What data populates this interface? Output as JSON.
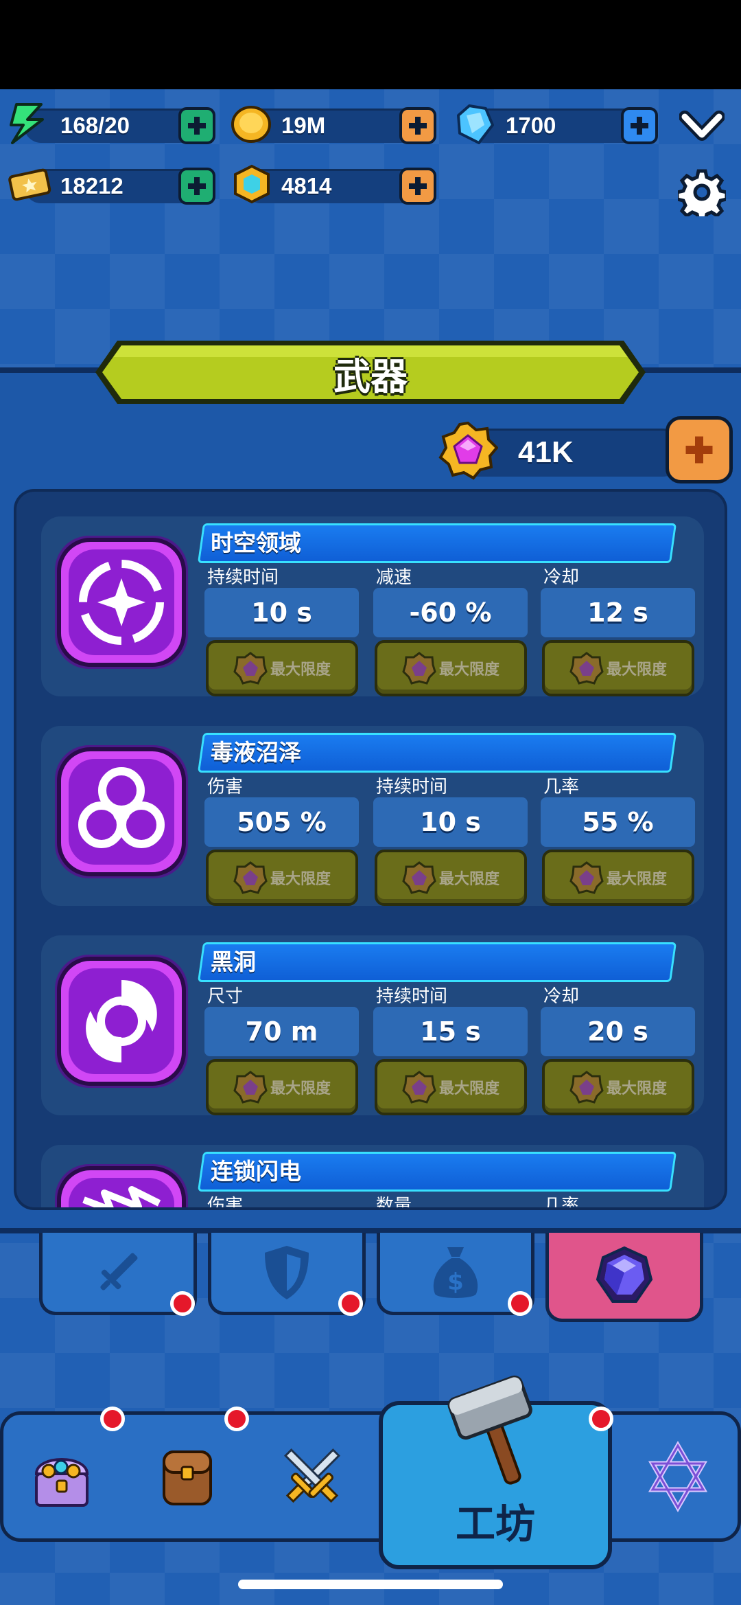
{
  "resources": {
    "energy": {
      "value": "168/20",
      "icon": "lightning-icon"
    },
    "coins": {
      "value": "19M",
      "icon": "coin-icon"
    },
    "diamonds": {
      "value": "1700",
      "icon": "diamond-icon"
    },
    "tickets": {
      "value": "18212",
      "icon": "ticket-icon"
    },
    "gems": {
      "value": "4814",
      "icon": "gem-coin-icon"
    }
  },
  "header": {
    "title": "武器"
  },
  "upgrade_currency": {
    "value": "41K",
    "icon": "purple-gem-icon"
  },
  "skills": [
    {
      "name": "时空领域",
      "icon": "time-space-icon",
      "stats": [
        {
          "label": "持续时间",
          "value": "10 s",
          "button": "最大限度"
        },
        {
          "label": "减速",
          "value": "-60 %",
          "button": "最大限度"
        },
        {
          "label": "冷却",
          "value": "12 s",
          "button": "最大限度"
        }
      ]
    },
    {
      "name": "毒液沼泽",
      "icon": "biohazard-icon",
      "stats": [
        {
          "label": "伤害",
          "value": "505 %",
          "button": "最大限度"
        },
        {
          "label": "持续时间",
          "value": "10 s",
          "button": "最大限度"
        },
        {
          "label": "几率",
          "value": "55 %",
          "button": "最大限度"
        }
      ]
    },
    {
      "name": "黑洞",
      "icon": "black-hole-icon",
      "stats": [
        {
          "label": "尺寸",
          "value": "70 m",
          "button": "最大限度"
        },
        {
          "label": "持续时间",
          "value": "15 s",
          "button": "最大限度"
        },
        {
          "label": "冷却",
          "value": "20 s",
          "button": "最大限度"
        }
      ]
    },
    {
      "name": "连锁闪电",
      "icon": "chain-lightning-icon",
      "stats": [
        {
          "label": "伤害",
          "value": ""
        },
        {
          "label": "数量",
          "value": ""
        },
        {
          "label": "几率",
          "value": ""
        }
      ]
    }
  ],
  "tabs": [
    {
      "icon": "sword-icon",
      "active": false
    },
    {
      "icon": "shield-icon",
      "active": false
    },
    {
      "icon": "money-bag-icon",
      "active": false
    },
    {
      "icon": "purple-gem-icon",
      "active": true
    }
  ],
  "bottom_nav": [
    {
      "icon": "treasure-chest-icon"
    },
    {
      "icon": "backpack-icon"
    },
    {
      "icon": "crossed-swords-icon"
    },
    {
      "icon": "hammer-icon",
      "label": "工坊",
      "active": true
    },
    {
      "icon": "star-of-david-icon"
    }
  ],
  "colors": {
    "header_banner": "#b5cc1f",
    "max_button": "#6a6d1a",
    "active_tab": "#e0558b",
    "skill_icon": "#b432e8"
  }
}
